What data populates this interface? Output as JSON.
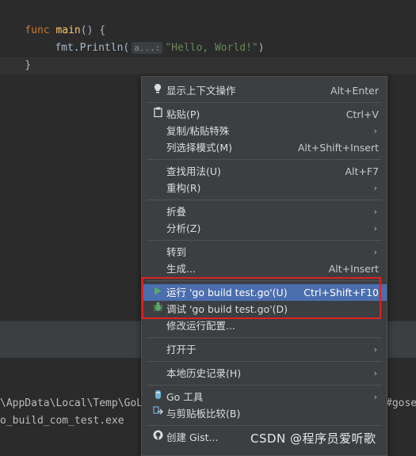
{
  "editor": {
    "line1": {
      "keyword": "func",
      "name": "main",
      "rest": "() {"
    },
    "line2": {
      "prefix": "fmt.Println(",
      "hint": "a...:",
      "string": "\"Hello, World!\"",
      "suffix": ")"
    },
    "line3": "}"
  },
  "terminal": {
    "line1_left": "\\AppData\\Local\\Temp\\GoL",
    "line1_right": "#gose",
    "line2": "o_build_com_test.exe"
  },
  "menu": {
    "items": [
      {
        "label": "显示上下文操作",
        "shortcut": "Alt+Enter",
        "icon": "lightbulb-icon"
      },
      {
        "label": "粘贴(P)",
        "shortcut": "Ctrl+V",
        "icon": "clipboard-icon"
      },
      {
        "label": "复制/粘贴特殊",
        "arrow": "›"
      },
      {
        "label": "列选择模式(M)",
        "shortcut": "Alt+Shift+Insert"
      },
      {
        "label": "查找用法(U)",
        "shortcut": "Alt+F7"
      },
      {
        "label": "重构(R)",
        "arrow": "›"
      },
      {
        "label": "折叠",
        "arrow": "›"
      },
      {
        "label": "分析(Z)",
        "arrow": "›"
      },
      {
        "label": "转到",
        "arrow": "›"
      },
      {
        "label": "生成...",
        "shortcut": "Alt+Insert"
      },
      {
        "label": "运行 'go build test.go'(U)",
        "shortcut": "Ctrl+Shift+F10",
        "icon": "run-icon"
      },
      {
        "label": "调试 'go build test.go'(D)",
        "icon": "debug-icon"
      },
      {
        "label": "修改运行配置..."
      },
      {
        "label": "打开于",
        "arrow": "›"
      },
      {
        "label": "本地历史记录(H)",
        "arrow": "›"
      },
      {
        "label": "Go 工具",
        "arrow": "›",
        "icon": "go-tools-icon"
      },
      {
        "label": "与剪贴板比较(B)",
        "icon": "compare-icon"
      },
      {
        "label": "创建 Gist...",
        "icon": "github-icon"
      }
    ]
  },
  "watermark": "CSDN @程序员爱听歌"
}
